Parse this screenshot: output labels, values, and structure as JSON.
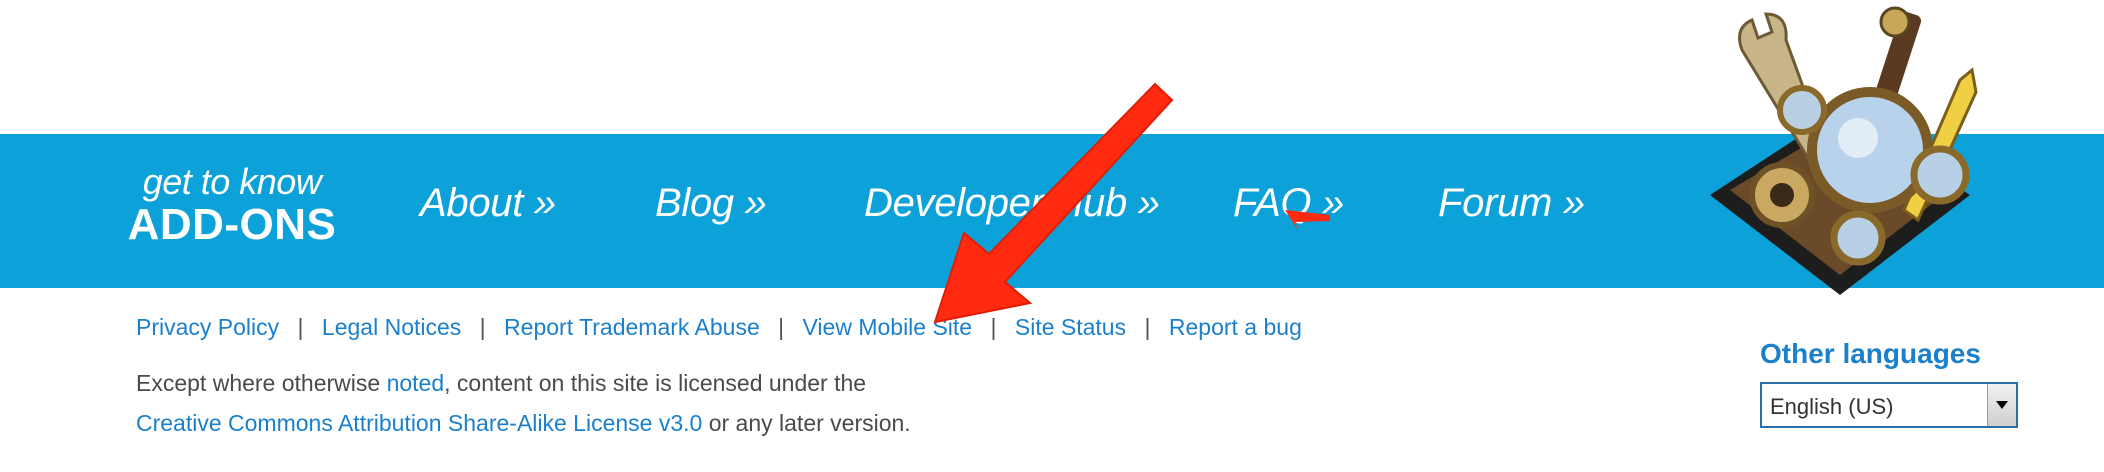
{
  "logo": {
    "line1": "get to know",
    "line2": "ADD-ONS"
  },
  "nav": [
    {
      "label": "About »"
    },
    {
      "label": "Blog »"
    },
    {
      "label": "Developer Hub »"
    },
    {
      "label": "FAQ »"
    },
    {
      "label": "Forum »"
    }
  ],
  "footer_links": [
    {
      "label": "Privacy Policy"
    },
    {
      "label": "Legal Notices"
    },
    {
      "label": "Report Trademark Abuse"
    },
    {
      "label": "View Mobile Site"
    },
    {
      "label": "Site Status"
    },
    {
      "label": "Report a bug"
    }
  ],
  "separator": "|",
  "license": {
    "text1": "Except where otherwise ",
    "link1": "noted",
    "text2": ", content on this site is licensed under the",
    "link2": "Creative Commons Attribution Share-Alike License v3.0",
    "text3": " or any later version."
  },
  "languages": {
    "title": "Other languages",
    "selected": "English (US)"
  },
  "colors": {
    "banner": "#0ca2d9",
    "link": "#1b80cc",
    "annotation_arrow": "#ff2a10"
  },
  "icons": {
    "mascot": "addons-tools-illustration",
    "dropdown": "chevron-down-icon",
    "annotation": "red-arrow"
  }
}
